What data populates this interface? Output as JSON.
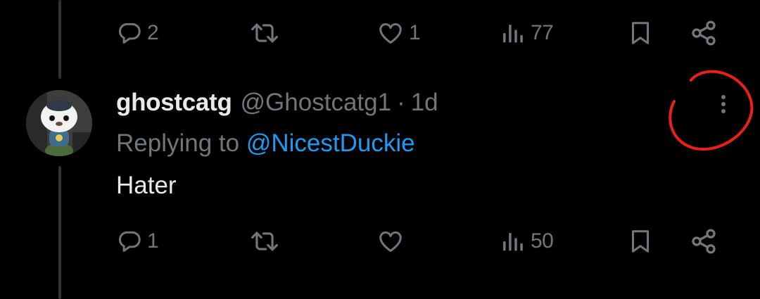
{
  "previous_tweet": {
    "actions": {
      "reply_count": "2",
      "retweet_count": "",
      "like_count": "1",
      "view_count": "77"
    }
  },
  "tweet": {
    "display_name": "ghostcatg",
    "handle": "@Ghostcatg1",
    "separator": "·",
    "timestamp": "1d",
    "replying_prefix": "Replying to ",
    "replying_to": "@NicestDuckie",
    "text": "Hater",
    "actions": {
      "reply_count": "1",
      "retweet_count": "",
      "like_count": "",
      "view_count": "50"
    }
  },
  "icons": {
    "reply": "reply-icon",
    "retweet": "retweet-icon",
    "like": "heart-icon",
    "views": "views-bar-chart-icon",
    "bookmark": "bookmark-icon",
    "share": "share-icon",
    "more": "more-vertical-icon"
  },
  "colors": {
    "background": "#000000",
    "primary_text": "#e7e9ea",
    "secondary_text": "#71767b",
    "mention": "#1d9bf0",
    "thread_line": "#2f3336",
    "annotation": "#e8201a"
  }
}
